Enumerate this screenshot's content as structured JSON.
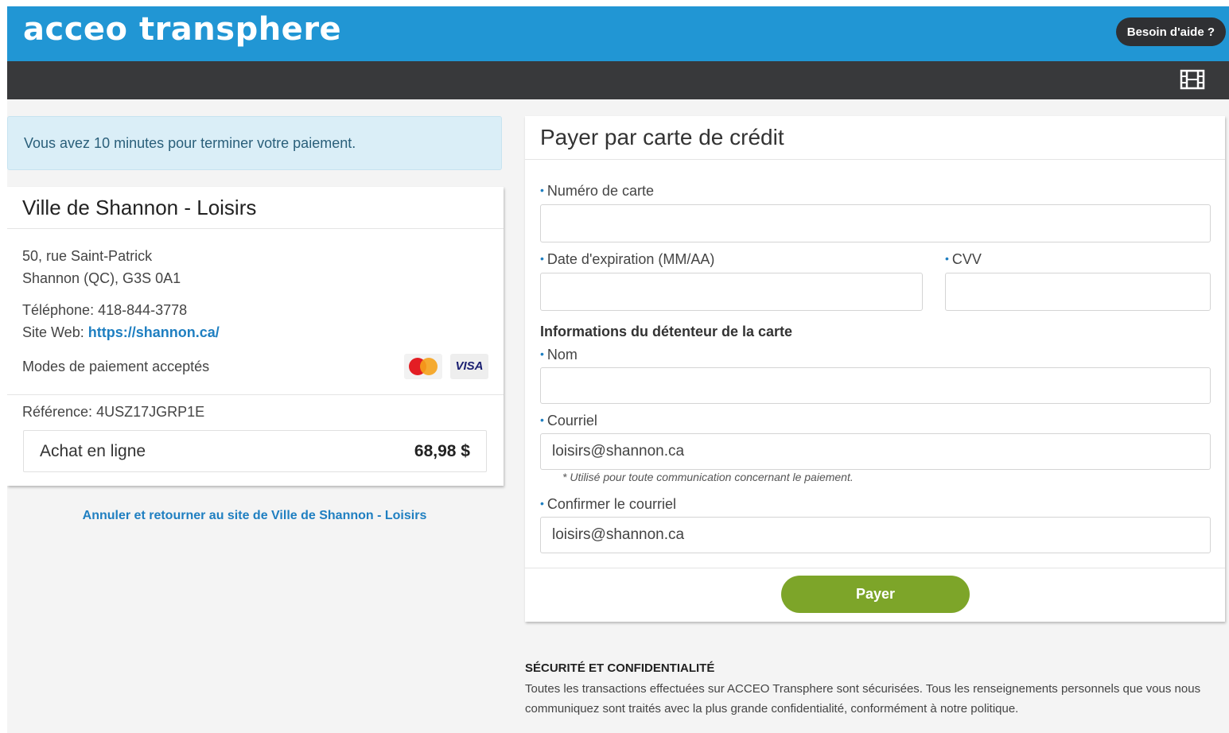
{
  "header": {
    "brand": "acceo transphere",
    "help_button": "Besoin d'aide ?",
    "toolbar_icon": "film-icon",
    "brand_color": "#2196d4",
    "bar_color": "#38393b"
  },
  "left": {
    "timer_alert": "Vous avez 10 minutes pour terminer votre paiement.",
    "merchant": {
      "name": "Ville de Shannon - Loisirs",
      "address_line1": "50, rue Saint-Patrick",
      "address_line2": "Shannon (QC), G3S 0A1",
      "phone_label": "Téléphone:",
      "phone": "418-844-3778",
      "web_label": "Site Web:",
      "web_url": "https://shannon.ca/",
      "payment_modes_label": "Modes de paiement acceptés",
      "card_logos": [
        "mastercard-logo",
        "visa-logo"
      ],
      "visa_text": "VISA",
      "reference_label": "Référence:",
      "reference": "4USZ17JGRP1E",
      "purchase_label": "Achat en ligne",
      "purchase_amount": "68,98 $"
    },
    "cancel_link": "Annuler et retourner au site de Ville de Shannon - Loisirs"
  },
  "form": {
    "heading": "Payer par carte de crédit",
    "card_number_label": "Numéro de carte",
    "card_number_value": "",
    "expiry_label": "Date d'expiration (MM/AA)",
    "expiry_value": "",
    "cvv_label": "CVV",
    "cvv_value": "",
    "holder_section": "Informations du détenteur de la carte",
    "name_label": "Nom",
    "name_value": "",
    "email_label": "Courriel",
    "email_value": "loisirs@shannon.ca",
    "email_hint": "* Utilisé pour toute communication concernant le paiement.",
    "confirm_email_label": "Confirmer le courriel",
    "confirm_email_value": "loisirs@shannon.ca",
    "required_bullet": "•",
    "pay_button": "Payer",
    "pay_button_color": "#7da529"
  },
  "security": {
    "title": "SÉCURITÉ ET CONFIDENTIALITÉ",
    "text": "Toutes les transactions effectuées sur ACCEO Transphere sont sécurisées. Tous les renseignements personnels que vous nous communiquez sont traités avec la plus grande confidentialité, conformément à notre politique."
  }
}
